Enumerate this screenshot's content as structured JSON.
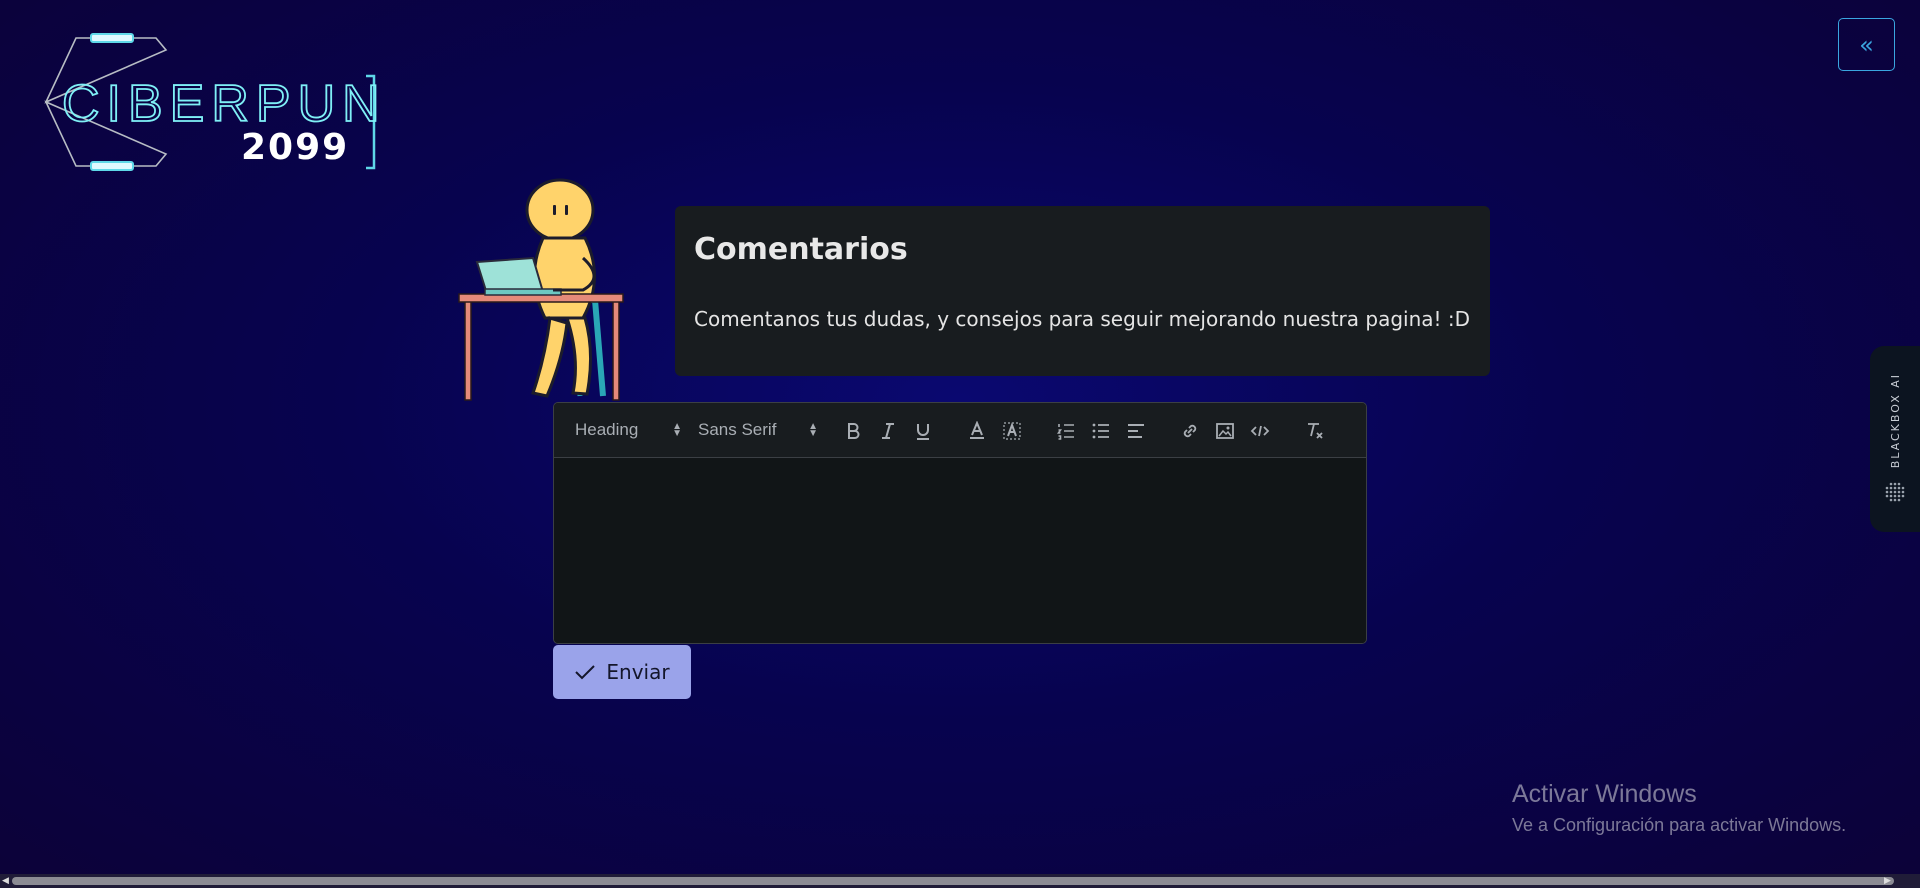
{
  "logo": {
    "line1": "CIBERPUNK",
    "line2": "2099"
  },
  "header": {
    "collapse_label": "«"
  },
  "info_card": {
    "title": "Comentarios",
    "text": "Comentanos tus dudas, y consejos para seguir mejorando nuestra pagina! :D"
  },
  "editor": {
    "heading_picker": "Heading",
    "font_picker": "Sans Serif",
    "tools": [
      "bold-icon",
      "italic-icon",
      "underline-icon",
      "text-color-icon",
      "highlight-icon",
      "ordered-list-icon",
      "bullet-list-icon",
      "align-icon",
      "link-icon",
      "image-icon",
      "code-icon",
      "clear-format-icon"
    ],
    "content": ""
  },
  "send_button": {
    "label": "Enviar"
  },
  "side_tab": {
    "label": "BLACKBOX AI"
  },
  "watermark": {
    "title": "Activar Windows",
    "subtitle": "Ve a Configuración para activar Windows."
  },
  "colors": {
    "accent": "#3aa6e0",
    "logo_cyan": "#5fd8e8",
    "card_bg": "#181c1f",
    "button_bg": "#9aa3ea"
  }
}
